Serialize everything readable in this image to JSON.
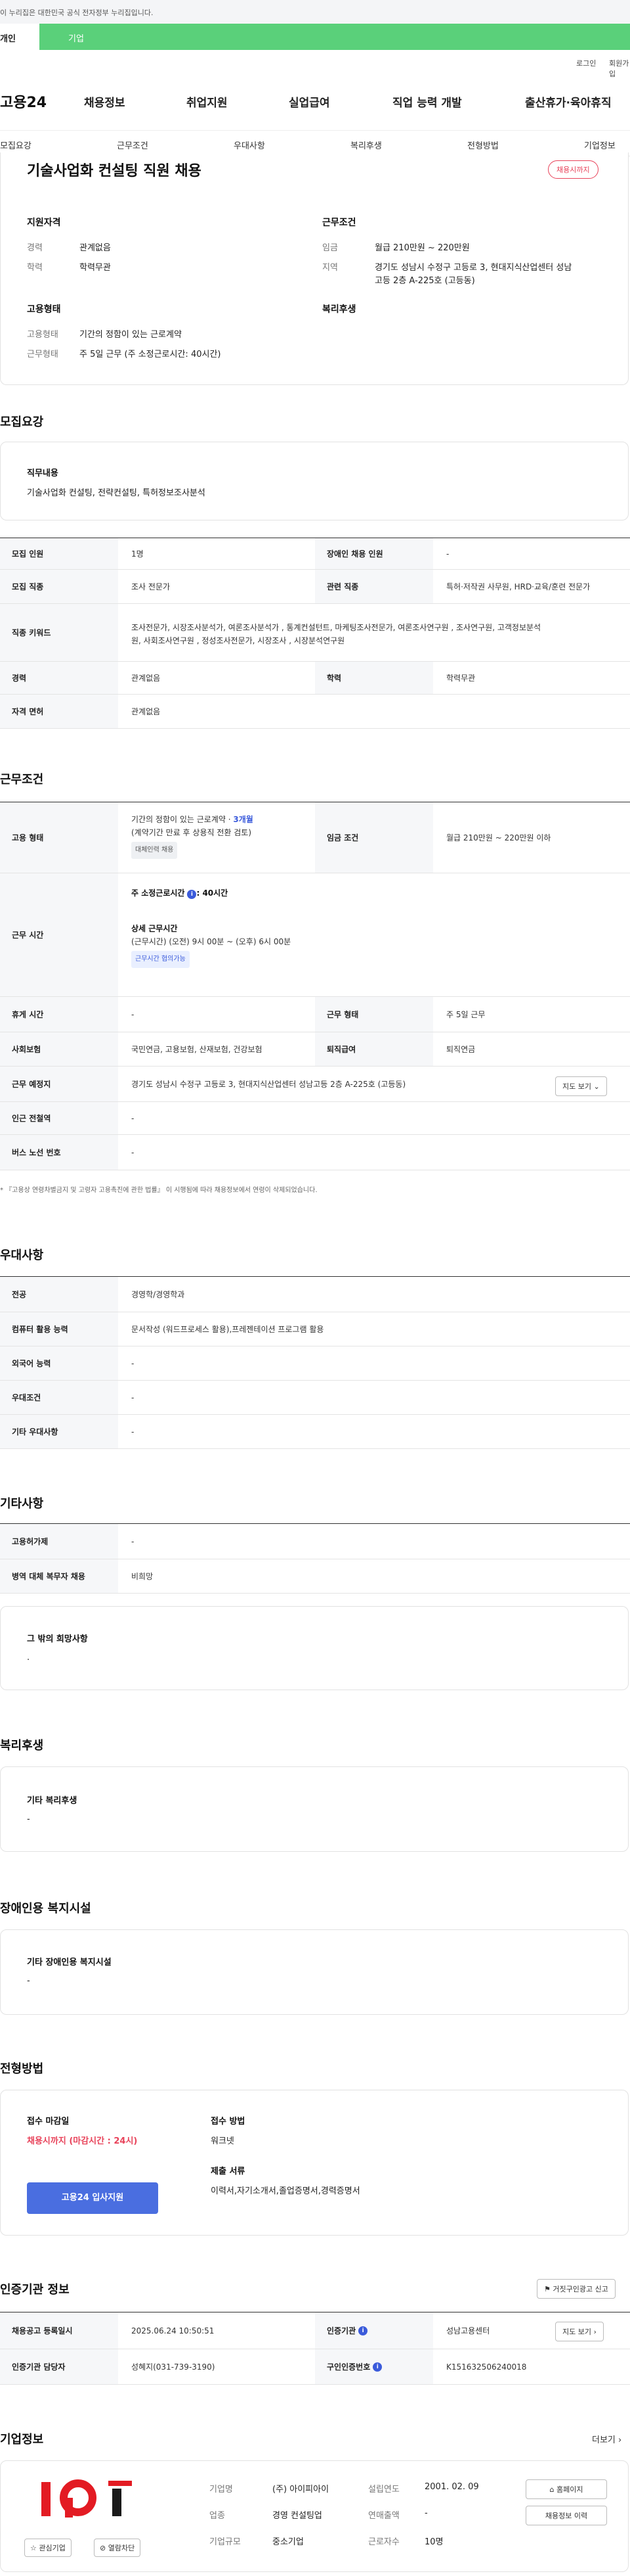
{
  "gov_notice": "이 누리집은 대한민국 공식 전자정부 누리집입니다.",
  "tabs": {
    "personal": "개인",
    "company": "기업"
  },
  "util": {
    "login": "로그인",
    "signup": "회원가입"
  },
  "logo": "고용24",
  "gnb": [
    "채용정보",
    "취업지원",
    "실업급여",
    "직업 능력 개발",
    "출산휴가·육아휴직"
  ],
  "subnav": [
    "모집요강",
    "근무조건",
    "우대사항",
    "복리후생",
    "전형방법",
    "기업정보"
  ],
  "summary": {
    "title": "기술사업화 컨설팅 직원 채용",
    "badge": "채용시까지",
    "qual_title": "지원자격",
    "career_label": "경력",
    "career_value": "관계없음",
    "edu_label": "학력",
    "edu_value": "학력무관",
    "cond_title": "근무조건",
    "wage_label": "임금",
    "wage_value": "월급 210만원 ~ 220만원",
    "area_label": "지역",
    "area_value_1": "경기도 성남시 수정구 고등로 3, 현대지식산업센터 성남",
    "area_value_2": "고등 2층 A-225호 (고등동)",
    "emp_title": "고용형태",
    "emp_type_label": "고용형태",
    "emp_type_value": "기간의 정함이 있는 근로계약",
    "work_type_label": "근무형태",
    "work_type_value": "주 5일 근무 (주 소정근로시간: 40시간)",
    "welfare_title": "복리후생"
  },
  "recruit": {
    "section": "모집요강",
    "duty_title": "직무내용",
    "duty_value": "기술사업화 컨설팅, 전략컨설팅, 특허정보조사분석",
    "rows": {
      "count_label": "모집 인원",
      "count_value": "1명",
      "disabled_label": "장애인 채용 인원",
      "disabled_value": "-",
      "job_label": "모집 직종",
      "job_value": "조사 전문가",
      "related_label": "관련 직종",
      "related_value": "특허·저작권 사무원, HRD·교육/훈련 전문가",
      "keyword_label": "직종 키워드",
      "keyword_value_1": "조사전문가, 시장조사분석가, 여론조사분석가 , 통계컨설턴트, 마케팅조사전문가, 여론조사연구원 , 조사연구원, 고객정보분석",
      "keyword_value_2": "원, 사회조사연구원 , 정성조사전문가, 시장조사 , 시장분석연구원",
      "career_label": "경력",
      "career_value": "관계없음",
      "edu_label": "학력",
      "edu_value": "학력무관",
      "license_label": "자격 면허",
      "license_value": "관계없음"
    }
  },
  "conditions": {
    "section": "근무조건",
    "emp_label": "고용 형태",
    "emp_value_prefix": "기간의 정함이 있는 근로계약 · ",
    "emp_value_months": "3개월",
    "emp_value_sub": "(계약기간 만료 후 상용직 전환 검토)",
    "emp_tag": "대체인력 채용",
    "wage_label": "임금 조건",
    "wage_value": "월급 210만원 ~ 220만원 이하",
    "hours_label": "근무 시간",
    "weekly_hours_title": "주 소정근로시간",
    "weekly_hours_value": ": 40시간",
    "detail_title": "상세 근무시간",
    "detail_value": "(근무시간) (오전) 9시 00분 ~ (오후) 6시 00분",
    "flex_tag": "근무시간 협의가능",
    "holiday_label": "휴게 시간",
    "holiday_value": "-",
    "worktype_label": "근무 형태",
    "worktype_value": "주 5일 근무",
    "insurance_label": "사회보험",
    "insurance_value": "국민연금, 고용보험, 산재보험, 건강보험",
    "severance_label": "퇴직급여",
    "severance_value": "퇴직연금",
    "place_label": "근무 예정지",
    "place_value": "경기도 성남시 수정구 고등로 3, 현대지식산업센터 성남고등 2층 A-225호 (고등동)",
    "map_button": "지도 보기",
    "subway_label": "인근 전철역",
    "subway_value": "-",
    "bus_label": "버스 노선 번호",
    "bus_value": "-",
    "note": "* 『고용상 연령차별금지 및 고령자 고용촉진에 관한 법률』 이 시행됨에 따라 채용정보에서 연령이 삭제되었습니다."
  },
  "preference": {
    "section": "우대사항",
    "major_label": "전공",
    "major_value": "경영학/경영학과",
    "computer_label": "컴퓨터 활용 능력",
    "computer_value": "문서작성 (워드프로세스 활용),프레젠테이션 프로그램 활용",
    "lang_label": "외국어 능력",
    "lang_value": "-",
    "cond_label": "우대조건",
    "cond_value": "-",
    "other_label": "기타 우대사항",
    "other_value": "-"
  },
  "etc": {
    "section": "기타사항",
    "permit_label": "고용허가제",
    "permit_value": "-",
    "military_label": "병역 대체 복무자 채용",
    "military_value": "비희망",
    "wish_title": "그 밖의 희망사항",
    "wish_value": "."
  },
  "welfare": {
    "section": "복리후생",
    "title": "기타 복리후생",
    "value": "-"
  },
  "disabled": {
    "section": "장애인용 복지시설",
    "title": "기타 장애인용 복지시설",
    "value": "-"
  },
  "selection": {
    "section": "전형방법",
    "deadline_title": "접수 마감일",
    "deadline_value": "채용시까지 (마감시간 : 24시)",
    "apply_button": "고용24 입사지원",
    "method_title": "접수 방법",
    "method_value": "워크넷",
    "docs_title": "제출 서류",
    "docs_value": "이력서,자기소개서,졸업증명서,경력증명서"
  },
  "cert": {
    "section": "인증기관 정보",
    "report_button": "거짓구인광고 신고",
    "reg_label": "채용공고 등록일시",
    "reg_value": "2025.06.24 10:50:51",
    "agency_label": "인증기관",
    "agency_value": "성남고용센터",
    "map_button": "지도 보기",
    "manager_label": "인증기관 담당자",
    "manager_value": "성혜지(031-739-3190)",
    "auth_label": "구인인증번호",
    "auth_value": "K151632506240018"
  },
  "company": {
    "section": "기업정보",
    "more": "더보기",
    "logo_text": "IPi",
    "name_label": "기업명",
    "name_value": "(주) 아이피아이",
    "founded_label": "설립연도",
    "founded_value": "2001. 02. 09",
    "industry_label": "업종",
    "industry_value": "경영 컨설팅업",
    "revenue_label": "연매출액",
    "revenue_value": "-",
    "scale_label": "기업규모",
    "scale_value": "중소기업",
    "workers_label": "근로자수",
    "workers_value": "10명",
    "homepage_button": "홈페이지",
    "history_button": "채용정보 이력",
    "interest_button": "관심기업",
    "block_button": "열람차단"
  }
}
